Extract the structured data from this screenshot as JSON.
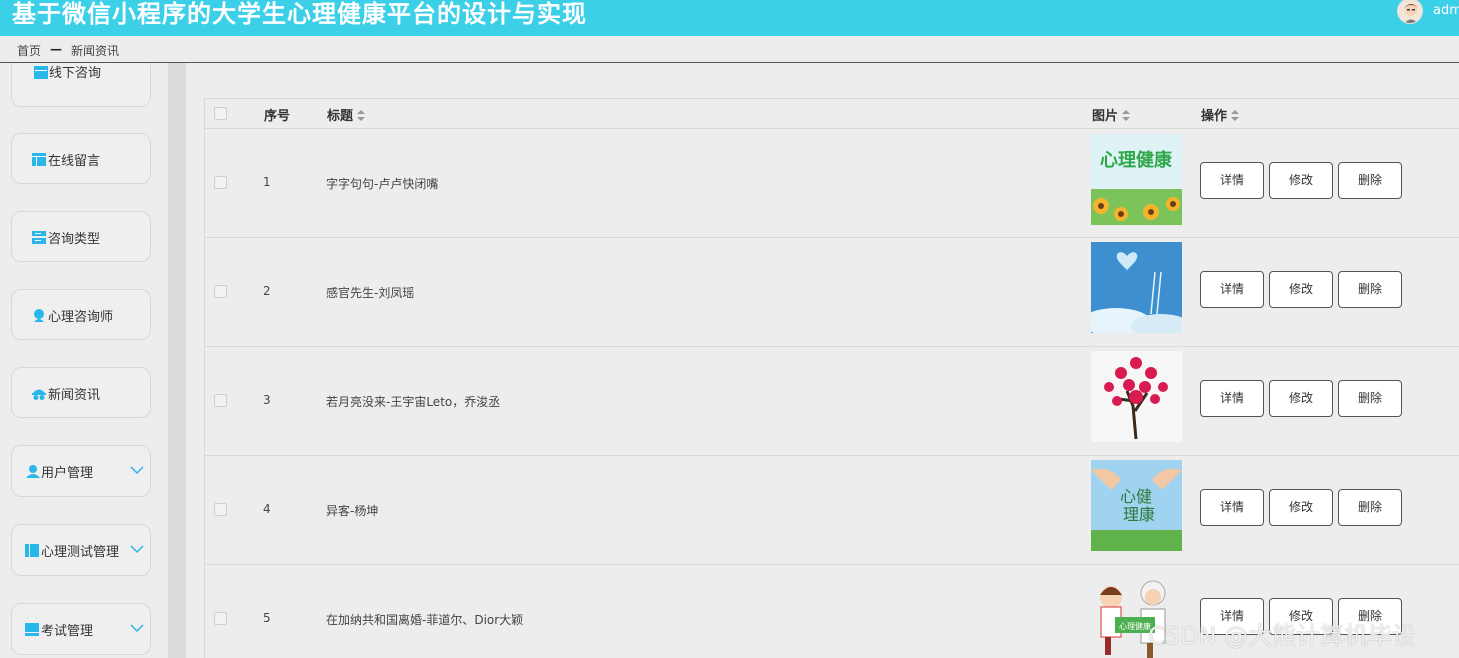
{
  "header": {
    "title": "基于微信小程序的大学生心理健康平台的设计与实现",
    "user": "adm"
  },
  "breadcrumb": {
    "home": "首页",
    "separator": "—",
    "current": "新闻资讯"
  },
  "sidebar": {
    "items": [
      {
        "label": "线下咨询",
        "icon": "table-icon"
      },
      {
        "label": "在线留言",
        "icon": "table-icon"
      },
      {
        "label": "咨询类型",
        "icon": "list-icon"
      },
      {
        "label": "心理咨询师",
        "icon": "person-icon"
      },
      {
        "label": "新闻资讯",
        "icon": "news-icon"
      },
      {
        "label": "用户管理",
        "icon": "user-icon",
        "expandable": true
      },
      {
        "label": "心理测试管理",
        "icon": "columns-icon",
        "expandable": true
      },
      {
        "label": "考试管理",
        "icon": "monitor-icon",
        "expandable": true
      }
    ]
  },
  "table": {
    "headers": {
      "index": "序号",
      "title": "标题",
      "image": "图片",
      "actions": "操作"
    },
    "rows": [
      {
        "index": "1",
        "title": "字字句句-卢卢快闭嘴",
        "image": "mental-health-sunflower-image"
      },
      {
        "index": "2",
        "title": "感官先生-刘凤瑶",
        "image": "sky-heart-ladder-image"
      },
      {
        "index": "3",
        "title": "若月亮没来-王宇宙Leto，乔浚丞",
        "image": "heart-tree-image"
      },
      {
        "index": "4",
        "title": "异客-杨坤",
        "image": "hands-mental-health-image"
      },
      {
        "index": "5",
        "title": "在加纳共和国离婚-菲道尔、Dior大颖",
        "image": "nurse-doctor-cartoon-image"
      }
    ],
    "buttons": {
      "detail": "详情",
      "edit": "修改",
      "delete": "删除"
    }
  },
  "watermark": "CSDN @大熊计算机毕设",
  "colors": {
    "header": "#3ccfe8",
    "accent_icon": "#29b6e8",
    "background": "#ededed"
  }
}
